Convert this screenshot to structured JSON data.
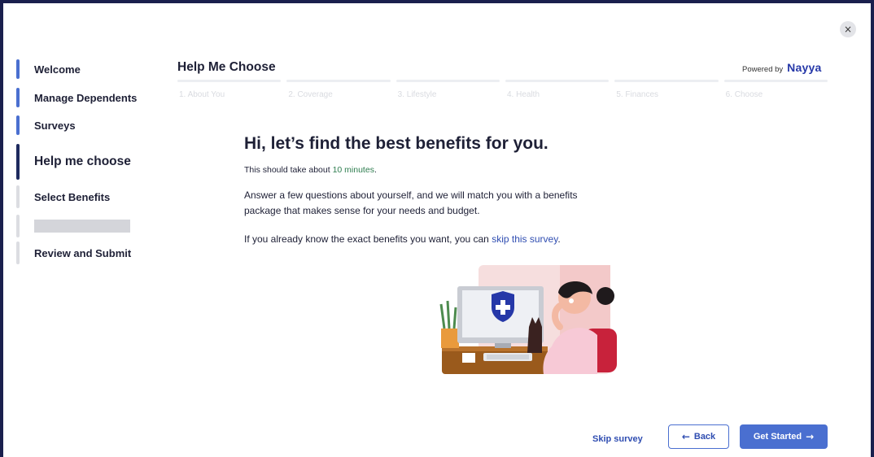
{
  "close": {
    "icon": "close-icon",
    "glyph": "×"
  },
  "sidebar": {
    "items": [
      {
        "label": "Welcome"
      },
      {
        "label": "Manage Dependents"
      },
      {
        "label": "Surveys"
      },
      {
        "label": "Help me choose"
      },
      {
        "label": "Select Benefits"
      },
      {
        "label": ""
      },
      {
        "label": "Review and Submit"
      }
    ]
  },
  "header": {
    "title": "Help Me Choose",
    "powered_by": "Powered by",
    "brand": "Nayya",
    "brand_color": "#2638a8"
  },
  "steps": [
    {
      "label": "1. About You"
    },
    {
      "label": "2. Coverage"
    },
    {
      "label": "3. Lifestyle"
    },
    {
      "label": "4. Health"
    },
    {
      "label": "5. Finances"
    },
    {
      "label": "6. Choose"
    }
  ],
  "main": {
    "headline": "Hi, let’s find the best benefits for you.",
    "duration_prefix": "This should take about ",
    "duration_value": "10 minutes",
    "duration_suffix": ".",
    "description": "Answer a few questions about yourself, and we will match you with a benefits package that makes sense for your needs and budget.",
    "skip_prefix": "If you already know the exact benefits you want, you can ",
    "skip_link": "skip this survey",
    "skip_suffix": "."
  },
  "footer": {
    "skip_label": "Skip survey",
    "back_label": "Back",
    "start_label": "Get Started"
  },
  "colors": {
    "accent": "#4a6fd0",
    "active_nav": "#1e2a5e",
    "link": "#2f4db1",
    "success_text": "#2e7d4f"
  }
}
